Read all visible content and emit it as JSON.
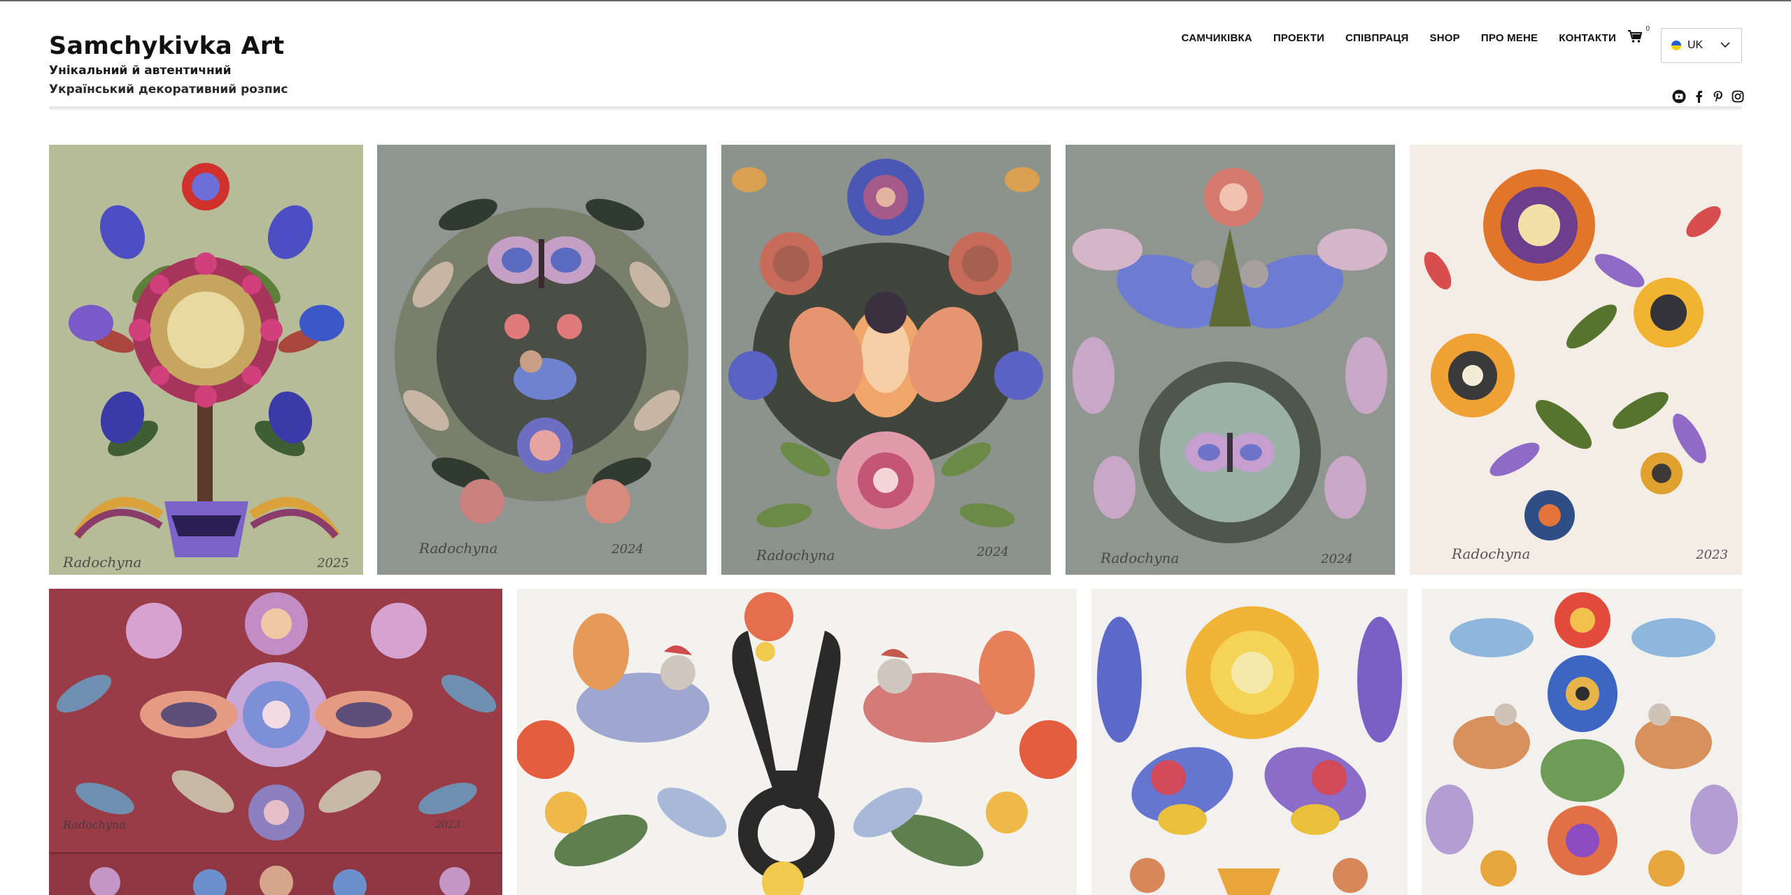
{
  "brand": {
    "title": "Samchykivka Art",
    "subtitle_line1": "Унікальний й автентичний",
    "subtitle_line2": "Український декоративний розпис"
  },
  "nav": {
    "items": [
      {
        "label": "САМЧИКІВКА"
      },
      {
        "label": "ПРОЕКТИ"
      },
      {
        "label": "СПІВПРАЦЯ"
      },
      {
        "label": "SHOP"
      },
      {
        "label": "ПРО МЕНЕ"
      },
      {
        "label": "КОНТАКТИ"
      }
    ]
  },
  "cart": {
    "icon": "cart-icon",
    "count": "0"
  },
  "language": {
    "selected": "UK",
    "icon": "ukraine-flag-icon"
  },
  "social": {
    "icons": [
      "youtube-icon",
      "facebook-icon",
      "pinterest-icon",
      "instagram-icon"
    ]
  },
  "colors": {
    "text": "#111111",
    "border": "#cfcfcf",
    "flag_blue": "#1f5fd0",
    "flag_yellow": "#f5d000"
  },
  "gallery": {
    "row1": [
      {
        "signature": "Radochyna",
        "year": "2025"
      },
      {
        "signature": "Radochyna",
        "year": "2024"
      },
      {
        "signature": "Radochyna",
        "year": "2024"
      },
      {
        "signature": "Radochyna",
        "year": "2024"
      },
      {
        "signature": "Radochyna",
        "year": "2023"
      }
    ],
    "row2": [
      {
        "signature": "Radochyna",
        "year": "2023"
      },
      {
        "signature": "",
        "year": ""
      },
      {
        "signature": "",
        "year": ""
      },
      {
        "signature": "",
        "year": ""
      }
    ]
  }
}
